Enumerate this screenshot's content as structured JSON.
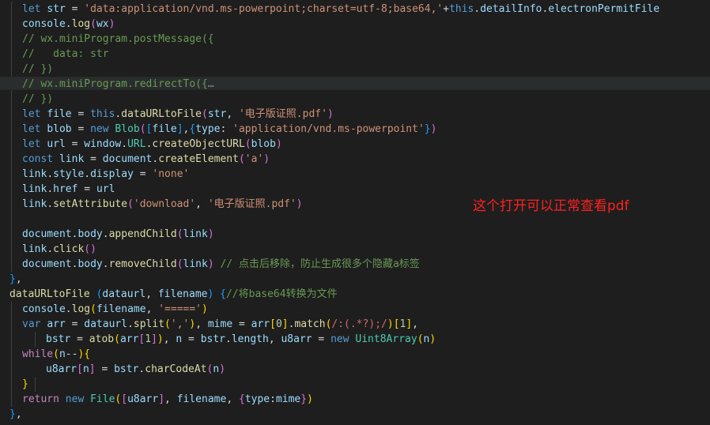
{
  "theme": {
    "background": "#1e1e1e",
    "keyword": "#569cd6",
    "control": "#c586c0",
    "variable": "#9cdcfe",
    "function": "#dcdcaa",
    "string": "#ce9178",
    "comment": "#6a9955",
    "class": "#4ec9b0",
    "number": "#b5cea8",
    "plain": "#d4d4d4",
    "regexp": "#d16969",
    "bracket_gold": "#ffd700",
    "bracket_purple": "#da70d6",
    "bracket_blue": "#179fff",
    "annotation": "#ff2020"
  },
  "annotation_text": "这个打开可以正常查看pdf",
  "lines": [
    {
      "indent": 28,
      "tokens": [
        {
          "t": "let",
          "c": "keyword"
        },
        {
          "t": " ",
          "c": "plain"
        },
        {
          "t": "str",
          "c": "variable"
        },
        {
          "t": " = ",
          "c": "plain"
        },
        {
          "t": "'data:application/vnd.ms-powerpoint;charset=utf-8;base64,'",
          "c": "string"
        },
        {
          "t": "+",
          "c": "plain"
        },
        {
          "t": "this",
          "c": "keyword"
        },
        {
          "t": ".",
          "c": "plain"
        },
        {
          "t": "detailInfo",
          "c": "variable"
        },
        {
          "t": ".",
          "c": "plain"
        },
        {
          "t": "electronPermitFile",
          "c": "variable"
        }
      ]
    },
    {
      "indent": 28,
      "tokens": [
        {
          "t": "console",
          "c": "variable"
        },
        {
          "t": ".",
          "c": "plain"
        },
        {
          "t": "log",
          "c": "function"
        },
        {
          "t": "(",
          "c": "bracket_purple"
        },
        {
          "t": "wx",
          "c": "variable"
        },
        {
          "t": ")",
          "c": "bracket_purple"
        }
      ]
    },
    {
      "indent": 28,
      "tokens": [
        {
          "t": "// wx.miniProgram.postMessage({",
          "c": "comment"
        }
      ]
    },
    {
      "indent": 28,
      "tokens": [
        {
          "t": "//   data: str",
          "c": "comment"
        }
      ]
    },
    {
      "indent": 28,
      "tokens": [
        {
          "t": "// })",
          "c": "comment"
        }
      ]
    },
    {
      "indent": 28,
      "highlight": true,
      "tokens": [
        {
          "t": "// wx.miniProgram.redirectTo({",
          "c": "comment"
        },
        {
          "t": "…",
          "c": "ellipsis"
        }
      ]
    },
    {
      "indent": 28,
      "tokens": [
        {
          "t": "// })",
          "c": "comment"
        }
      ]
    },
    {
      "indent": 28,
      "tokens": [
        {
          "t": "let",
          "c": "keyword"
        },
        {
          "t": " ",
          "c": "plain"
        },
        {
          "t": "file",
          "c": "variable"
        },
        {
          "t": " = ",
          "c": "plain"
        },
        {
          "t": "this",
          "c": "keyword"
        },
        {
          "t": ".",
          "c": "plain"
        },
        {
          "t": "dataURLtoFile",
          "c": "function"
        },
        {
          "t": "(",
          "c": "bracket_purple"
        },
        {
          "t": "str",
          "c": "variable"
        },
        {
          "t": ", ",
          "c": "plain"
        },
        {
          "t": "'电子版证照.pdf'",
          "c": "string"
        },
        {
          "t": ")",
          "c": "bracket_purple"
        }
      ]
    },
    {
      "indent": 28,
      "tokens": [
        {
          "t": "let",
          "c": "keyword"
        },
        {
          "t": " ",
          "c": "plain"
        },
        {
          "t": "blob",
          "c": "variable"
        },
        {
          "t": " = ",
          "c": "plain"
        },
        {
          "t": "new",
          "c": "keyword"
        },
        {
          "t": " ",
          "c": "plain"
        },
        {
          "t": "Blob",
          "c": "class"
        },
        {
          "t": "(",
          "c": "bracket_purple"
        },
        {
          "t": "[",
          "c": "bracket_blue"
        },
        {
          "t": "file",
          "c": "variable"
        },
        {
          "t": "]",
          "c": "bracket_blue"
        },
        {
          "t": ",",
          "c": "plain"
        },
        {
          "t": "{",
          "c": "bracket_blue"
        },
        {
          "t": "type",
          "c": "variable"
        },
        {
          "t": ": ",
          "c": "plain"
        },
        {
          "t": "'application/vnd.ms-powerpoint'",
          "c": "string"
        },
        {
          "t": "}",
          "c": "bracket_blue"
        },
        {
          "t": ")",
          "c": "bracket_purple"
        }
      ]
    },
    {
      "indent": 28,
      "tokens": [
        {
          "t": "let",
          "c": "keyword"
        },
        {
          "t": " ",
          "c": "plain"
        },
        {
          "t": "url",
          "c": "variable"
        },
        {
          "t": " = ",
          "c": "plain"
        },
        {
          "t": "window",
          "c": "variable"
        },
        {
          "t": ".",
          "c": "plain"
        },
        {
          "t": "URL",
          "c": "class"
        },
        {
          "t": ".",
          "c": "plain"
        },
        {
          "t": "createObjectURL",
          "c": "function"
        },
        {
          "t": "(",
          "c": "bracket_purple"
        },
        {
          "t": "blob",
          "c": "variable"
        },
        {
          "t": ")",
          "c": "bracket_purple"
        }
      ]
    },
    {
      "indent": 28,
      "tokens": [
        {
          "t": "const",
          "c": "keyword"
        },
        {
          "t": " ",
          "c": "plain"
        },
        {
          "t": "link",
          "c": "variable"
        },
        {
          "t": " = ",
          "c": "plain"
        },
        {
          "t": "document",
          "c": "variable"
        },
        {
          "t": ".",
          "c": "plain"
        },
        {
          "t": "createElement",
          "c": "function"
        },
        {
          "t": "(",
          "c": "bracket_purple"
        },
        {
          "t": "'a'",
          "c": "string"
        },
        {
          "t": ")",
          "c": "bracket_purple"
        }
      ]
    },
    {
      "indent": 28,
      "tokens": [
        {
          "t": "link",
          "c": "variable"
        },
        {
          "t": ".",
          "c": "plain"
        },
        {
          "t": "style",
          "c": "variable"
        },
        {
          "t": ".",
          "c": "plain"
        },
        {
          "t": "display",
          "c": "variable"
        },
        {
          "t": " = ",
          "c": "plain"
        },
        {
          "t": "'none'",
          "c": "string"
        }
      ]
    },
    {
      "indent": 28,
      "tokens": [
        {
          "t": "link",
          "c": "variable"
        },
        {
          "t": ".",
          "c": "plain"
        },
        {
          "t": "href",
          "c": "variable"
        },
        {
          "t": " = ",
          "c": "plain"
        },
        {
          "t": "url",
          "c": "variable"
        }
      ]
    },
    {
      "indent": 28,
      "tokens": [
        {
          "t": "link",
          "c": "variable"
        },
        {
          "t": ".",
          "c": "plain"
        },
        {
          "t": "setAttribute",
          "c": "function"
        },
        {
          "t": "(",
          "c": "bracket_purple"
        },
        {
          "t": "'download'",
          "c": "string"
        },
        {
          "t": ", ",
          "c": "plain"
        },
        {
          "t": "'电子版证照.pdf'",
          "c": "string"
        },
        {
          "t": ")",
          "c": "bracket_purple"
        }
      ]
    },
    {
      "indent": 28,
      "tokens": []
    },
    {
      "indent": 28,
      "tokens": [
        {
          "t": "document",
          "c": "variable"
        },
        {
          "t": ".",
          "c": "plain"
        },
        {
          "t": "body",
          "c": "variable"
        },
        {
          "t": ".",
          "c": "plain"
        },
        {
          "t": "appendChild",
          "c": "function"
        },
        {
          "t": "(",
          "c": "bracket_purple"
        },
        {
          "t": "link",
          "c": "variable"
        },
        {
          "t": ")",
          "c": "bracket_purple"
        }
      ]
    },
    {
      "indent": 28,
      "tokens": [
        {
          "t": "link",
          "c": "variable"
        },
        {
          "t": ".",
          "c": "plain"
        },
        {
          "t": "click",
          "c": "function"
        },
        {
          "t": "(",
          "c": "bracket_purple"
        },
        {
          "t": ")",
          "c": "bracket_purple"
        }
      ]
    },
    {
      "indent": 28,
      "tokens": [
        {
          "t": "document",
          "c": "variable"
        },
        {
          "t": ".",
          "c": "plain"
        },
        {
          "t": "body",
          "c": "variable"
        },
        {
          "t": ".",
          "c": "plain"
        },
        {
          "t": "removeChild",
          "c": "function"
        },
        {
          "t": "(",
          "c": "bracket_purple"
        },
        {
          "t": "link",
          "c": "variable"
        },
        {
          "t": ")",
          "c": "bracket_purple"
        },
        {
          "t": " ",
          "c": "plain"
        },
        {
          "t": "// 点击后移除，防止生成很多个隐藏a标签",
          "c": "comment"
        }
      ]
    },
    {
      "indent": 12,
      "tokens": [
        {
          "t": "}",
          "c": "bracket_blue"
        },
        {
          "t": ",",
          "c": "plain"
        }
      ]
    },
    {
      "indent": 12,
      "tokens": [
        {
          "t": "dataURLtoFile",
          "c": "function"
        },
        {
          "t": " ",
          "c": "plain"
        },
        {
          "t": "(",
          "c": "bracket_blue"
        },
        {
          "t": "dataurl",
          "c": "variable"
        },
        {
          "t": ", ",
          "c": "plain"
        },
        {
          "t": "filename",
          "c": "variable"
        },
        {
          "t": ")",
          "c": "bracket_blue"
        },
        {
          "t": " ",
          "c": "plain"
        },
        {
          "t": "{",
          "c": "bracket_blue"
        },
        {
          "t": "//将base64转换为文件",
          "c": "comment"
        }
      ]
    },
    {
      "indent": 28,
      "tokens": [
        {
          "t": "console",
          "c": "variable"
        },
        {
          "t": ".",
          "c": "plain"
        },
        {
          "t": "log",
          "c": "function"
        },
        {
          "t": "(",
          "c": "bracket_gold"
        },
        {
          "t": "filename",
          "c": "variable"
        },
        {
          "t": ", ",
          "c": "plain"
        },
        {
          "t": "'====='",
          "c": "string"
        },
        {
          "t": ")",
          "c": "bracket_gold"
        }
      ]
    },
    {
      "indent": 28,
      "tokens": [
        {
          "t": "var",
          "c": "keyword"
        },
        {
          "t": " ",
          "c": "plain"
        },
        {
          "t": "arr",
          "c": "variable"
        },
        {
          "t": " = ",
          "c": "plain"
        },
        {
          "t": "dataurl",
          "c": "variable"
        },
        {
          "t": ".",
          "c": "plain"
        },
        {
          "t": "split",
          "c": "function"
        },
        {
          "t": "(",
          "c": "bracket_gold"
        },
        {
          "t": "','",
          "c": "string"
        },
        {
          "t": ")",
          "c": "bracket_gold"
        },
        {
          "t": ", ",
          "c": "plain"
        },
        {
          "t": "mime",
          "c": "variable"
        },
        {
          "t": " = ",
          "c": "plain"
        },
        {
          "t": "arr",
          "c": "variable"
        },
        {
          "t": "[",
          "c": "bracket_gold"
        },
        {
          "t": "0",
          "c": "number"
        },
        {
          "t": "]",
          "c": "bracket_gold"
        },
        {
          "t": ".",
          "c": "plain"
        },
        {
          "t": "match",
          "c": "function"
        },
        {
          "t": "(",
          "c": "bracket_gold"
        },
        {
          "t": "/:(.*?);/",
          "c": "regexp"
        },
        {
          "t": ")",
          "c": "bracket_gold"
        },
        {
          "t": "[",
          "c": "bracket_gold"
        },
        {
          "t": "1",
          "c": "number"
        },
        {
          "t": "]",
          "c": "bracket_gold"
        },
        {
          "t": ",",
          "c": "plain"
        }
      ]
    },
    {
      "indent": 58,
      "tokens": [
        {
          "t": "bstr",
          "c": "variable"
        },
        {
          "t": " = ",
          "c": "plain"
        },
        {
          "t": "atob",
          "c": "function"
        },
        {
          "t": "(",
          "c": "bracket_gold"
        },
        {
          "t": "arr",
          "c": "variable"
        },
        {
          "t": "[",
          "c": "bracket_purple"
        },
        {
          "t": "1",
          "c": "number"
        },
        {
          "t": "]",
          "c": "bracket_purple"
        },
        {
          "t": ")",
          "c": "bracket_gold"
        },
        {
          "t": ", ",
          "c": "plain"
        },
        {
          "t": "n",
          "c": "variable"
        },
        {
          "t": " = ",
          "c": "plain"
        },
        {
          "t": "bstr",
          "c": "variable"
        },
        {
          "t": ".",
          "c": "plain"
        },
        {
          "t": "length",
          "c": "variable"
        },
        {
          "t": ", ",
          "c": "plain"
        },
        {
          "t": "u8arr",
          "c": "variable"
        },
        {
          "t": " = ",
          "c": "plain"
        },
        {
          "t": "new",
          "c": "keyword"
        },
        {
          "t": " ",
          "c": "plain"
        },
        {
          "t": "Uint8Array",
          "c": "class"
        },
        {
          "t": "(",
          "c": "bracket_gold"
        },
        {
          "t": "n",
          "c": "variable"
        },
        {
          "t": ")",
          "c": "bracket_gold"
        }
      ]
    },
    {
      "indent": 28,
      "tokens": [
        {
          "t": "while",
          "c": "control"
        },
        {
          "t": "(",
          "c": "bracket_gold"
        },
        {
          "t": "n",
          "c": "variable"
        },
        {
          "t": "--",
          "c": "plain"
        },
        {
          "t": ")",
          "c": "bracket_gold"
        },
        {
          "t": "{",
          "c": "bracket_gold"
        }
      ]
    },
    {
      "indent": 58,
      "tokens": [
        {
          "t": "u8arr",
          "c": "variable"
        },
        {
          "t": "[",
          "c": "bracket_purple"
        },
        {
          "t": "n",
          "c": "variable"
        },
        {
          "t": "]",
          "c": "bracket_purple"
        },
        {
          "t": " = ",
          "c": "plain"
        },
        {
          "t": "bstr",
          "c": "variable"
        },
        {
          "t": ".",
          "c": "plain"
        },
        {
          "t": "charCodeAt",
          "c": "function"
        },
        {
          "t": "(",
          "c": "bracket_purple"
        },
        {
          "t": "n",
          "c": "variable"
        },
        {
          "t": ")",
          "c": "bracket_purple"
        }
      ]
    },
    {
      "indent": 28,
      "tokens": [
        {
          "t": "}",
          "c": "bracket_gold"
        }
      ]
    },
    {
      "indent": 28,
      "tokens": [
        {
          "t": "return",
          "c": "control"
        },
        {
          "t": " ",
          "c": "plain"
        },
        {
          "t": "new",
          "c": "keyword"
        },
        {
          "t": " ",
          "c": "plain"
        },
        {
          "t": "File",
          "c": "class"
        },
        {
          "t": "(",
          "c": "bracket_gold"
        },
        {
          "t": "[",
          "c": "bracket_purple"
        },
        {
          "t": "u8arr",
          "c": "variable"
        },
        {
          "t": "]",
          "c": "bracket_purple"
        },
        {
          "t": ", ",
          "c": "plain"
        },
        {
          "t": "filename",
          "c": "variable"
        },
        {
          "t": ", ",
          "c": "plain"
        },
        {
          "t": "{",
          "c": "bracket_purple"
        },
        {
          "t": "type",
          "c": "variable"
        },
        {
          "t": ":",
          "c": "plain"
        },
        {
          "t": "mime",
          "c": "variable"
        },
        {
          "t": "}",
          "c": "bracket_purple"
        },
        {
          "t": ")",
          "c": "bracket_gold"
        }
      ]
    },
    {
      "indent": 12,
      "tokens": [
        {
          "t": "}",
          "c": "bracket_blue"
        },
        {
          "t": ",",
          "c": "plain"
        }
      ]
    }
  ]
}
